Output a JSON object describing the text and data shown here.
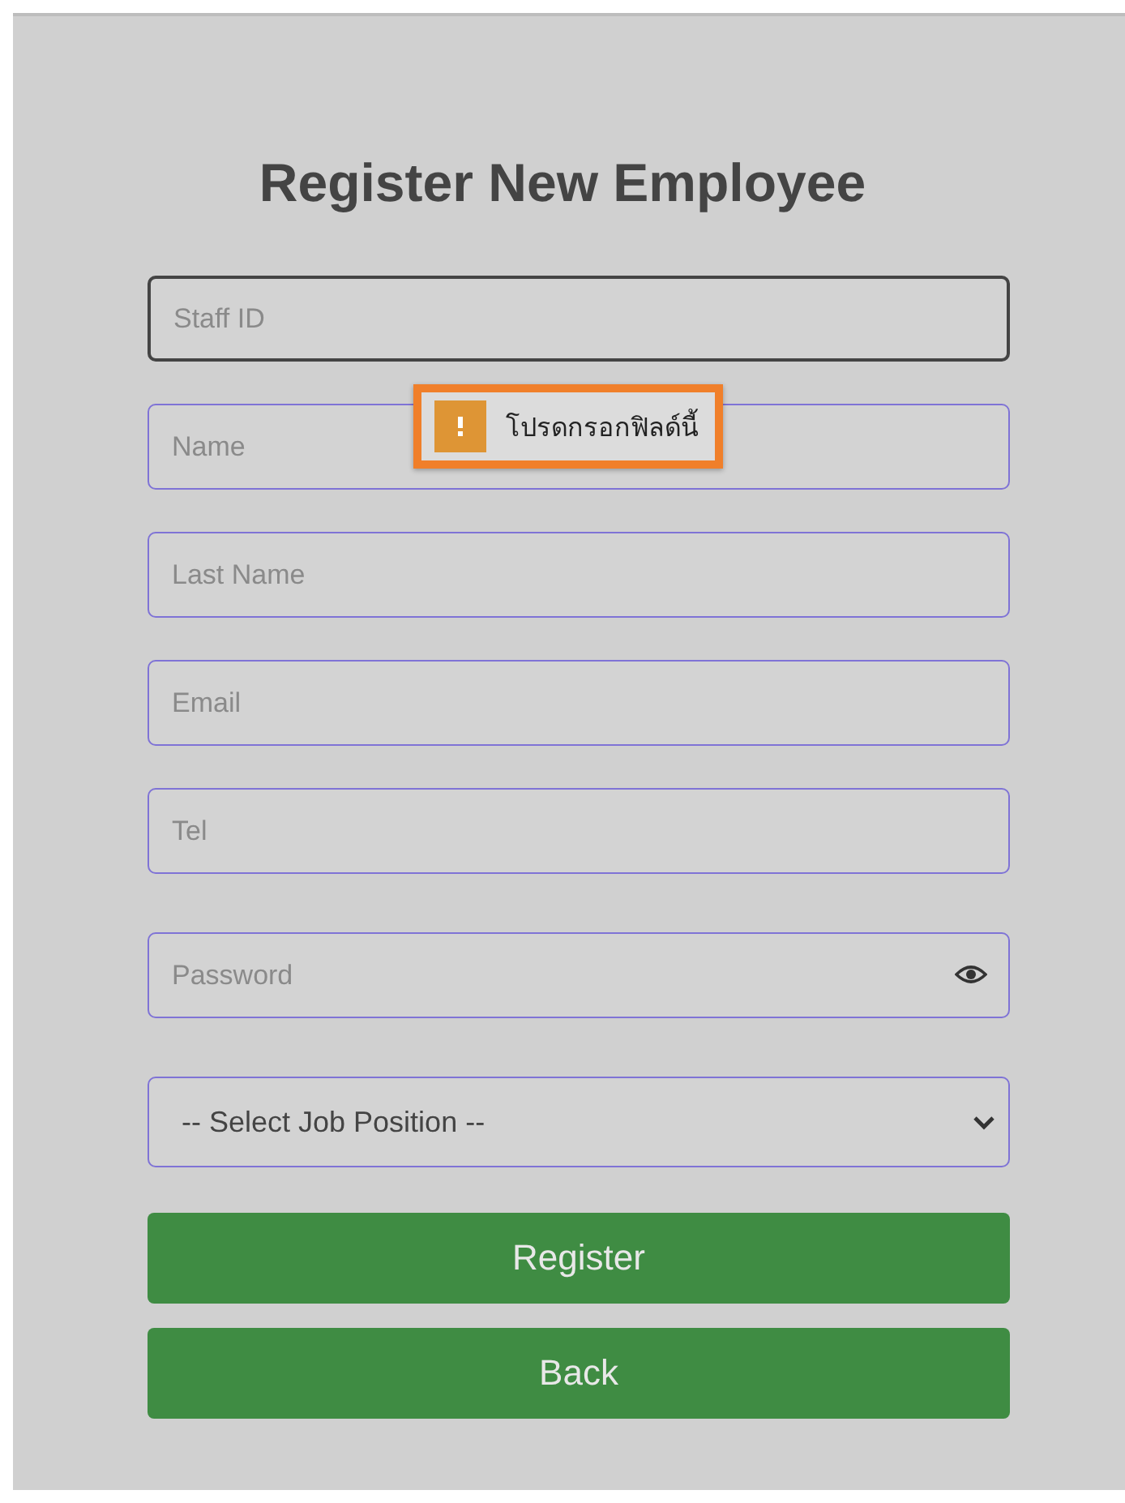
{
  "title": "Register New Employee",
  "fields": [
    {
      "kind": "text",
      "placeholder": "Staff ID",
      "focused": true
    },
    {
      "kind": "text",
      "placeholder": "Name",
      "focused": false
    },
    {
      "kind": "text",
      "placeholder": "Last Name",
      "focused": false
    },
    {
      "kind": "text",
      "placeholder": "Email",
      "focused": false
    },
    {
      "kind": "text",
      "placeholder": "Tel",
      "focused": false
    },
    {
      "kind": "password",
      "placeholder": "Password",
      "focused": false
    },
    {
      "kind": "select",
      "value": "-- Select Job Position --",
      "focused": false
    }
  ],
  "tooltip": {
    "message": "โปรดกรอกฟิลด์นี้"
  },
  "buttons": [
    {
      "label": "Register"
    },
    {
      "label": "Back"
    }
  ]
}
